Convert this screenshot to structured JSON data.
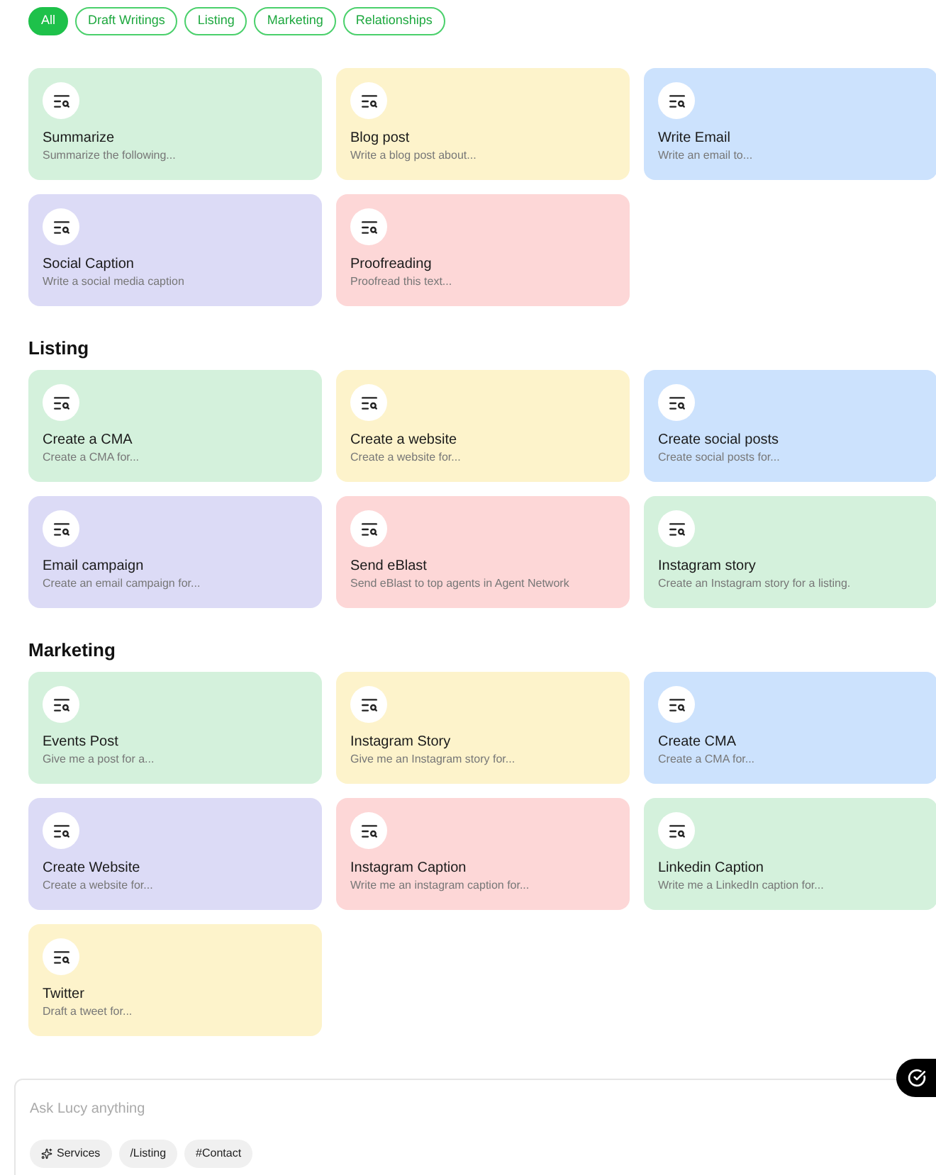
{
  "filters": [
    {
      "label": "All",
      "selected": true
    },
    {
      "label": "Draft Writings",
      "selected": false
    },
    {
      "label": "Listing",
      "selected": false
    },
    {
      "label": "Marketing",
      "selected": false
    },
    {
      "label": "Relationships",
      "selected": false
    }
  ],
  "sections": [
    {
      "cards": [
        {
          "title": "Summarize",
          "subtitle": "Summarize the following...",
          "color": "#d4f1dc"
        },
        {
          "title": "Blog post",
          "subtitle": "Write a blog post about...",
          "color": "#fdf3cb"
        },
        {
          "title": "Write Email",
          "subtitle": "Write an email to...",
          "color": "#cce2fd"
        },
        {
          "title": "Social Caption",
          "subtitle": "Write a social media caption",
          "color": "#dcdbf6"
        },
        {
          "title": "Proofreading",
          "subtitle": "Proofread this text...",
          "color": "#fdd7d7"
        }
      ]
    },
    {
      "title": "Listing",
      "cards": [
        {
          "title": "Create a CMA",
          "subtitle": "Create a CMA for...",
          "color": "#d4f1dc"
        },
        {
          "title": "Create a website",
          "subtitle": "Create a website for...",
          "color": "#fdf3cb"
        },
        {
          "title": "Create social posts",
          "subtitle": "Create social posts for...",
          "color": "#cce2fd"
        },
        {
          "title": "Email campaign",
          "subtitle": "Create an email campaign for...",
          "color": "#dcdbf6"
        },
        {
          "title": "Send eBlast",
          "subtitle": "Send eBlast to top agents in Agent Network",
          "color": "#fdd7d7"
        },
        {
          "title": "Instagram story",
          "subtitle": "Create an Instagram story for a listing.",
          "color": "#d4f1dc"
        }
      ]
    },
    {
      "title": "Marketing",
      "cards": [
        {
          "title": "Events Post",
          "subtitle": "Give me a post for a...",
          "color": "#d4f1dc"
        },
        {
          "title": "Instagram Story",
          "subtitle": "Give me an Instagram story for...",
          "color": "#fdf3cb"
        },
        {
          "title": "Create CMA",
          "subtitle": "Create a CMA for...",
          "color": "#cce2fd"
        },
        {
          "title": "Create Website",
          "subtitle": "Create a website for...",
          "color": "#dcdbf6"
        },
        {
          "title": "Instagram Caption",
          "subtitle": "Write me an instagram caption for...",
          "color": "#fdd7d7"
        },
        {
          "title": "Linkedin Caption",
          "subtitle": "Write me a LinkedIn caption for...",
          "color": "#d4f1dc"
        },
        {
          "title": "Twitter",
          "subtitle": "Draft a tweet for...",
          "color": "#fdf3cb"
        }
      ]
    }
  ],
  "composer": {
    "placeholder": "Ask Lucy anything",
    "chips": [
      {
        "label": "Services",
        "kind": "sparkle"
      },
      {
        "label": "/Listing",
        "kind": "plain"
      },
      {
        "label": "#Contact",
        "kind": "plain"
      }
    ]
  }
}
